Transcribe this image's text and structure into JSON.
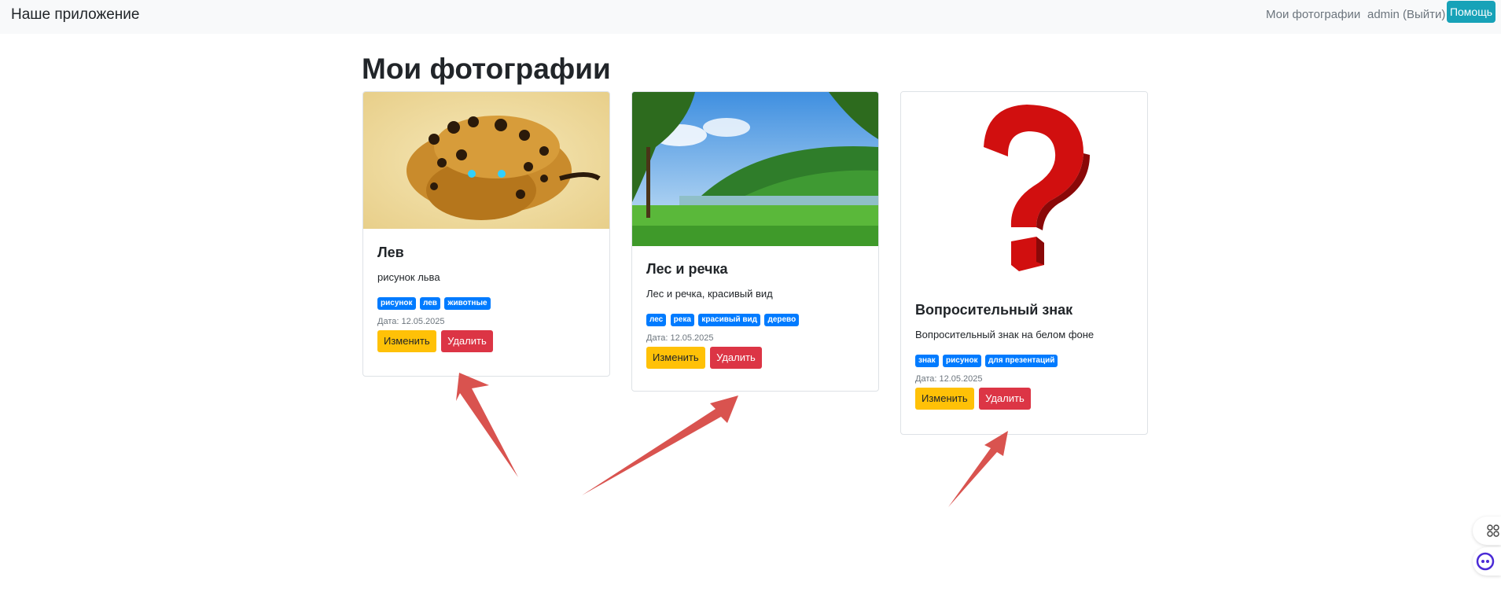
{
  "navbar": {
    "brand": "Наше приложение",
    "my_photos": "Мои фотографии",
    "user": "admin (Выйти)",
    "help": "Помощь"
  },
  "page": {
    "title": "Мои фотографии"
  },
  "cards": [
    {
      "title": "Лев",
      "description": "рисунок льва",
      "tags": [
        "рисунок",
        "лев",
        "животные"
      ],
      "date": "Дата: 12.05.2025",
      "edit": "Изменить",
      "delete": "Удалить"
    },
    {
      "title": "Лес и речка",
      "description": "Лес и речка, красивый вид",
      "tags": [
        "лес",
        "река",
        "красивый вид",
        "дерево"
      ],
      "date": "Дата: 12.05.2025",
      "edit": "Изменить",
      "delete": "Удалить"
    },
    {
      "title": "Вопросительный знак",
      "description": "Вопросительный знак на белом фоне",
      "tags": [
        "знак",
        "рисунок",
        "для презентаций"
      ],
      "date": "Дата: 12.05.2025",
      "edit": "Изменить",
      "delete": "Удалить"
    }
  ],
  "colors": {
    "tag": "#007bff",
    "edit_button": "#ffc107",
    "delete_button": "#dc3545",
    "help_button": "#17a2b8",
    "annotation_arrow": "#d9534f"
  }
}
